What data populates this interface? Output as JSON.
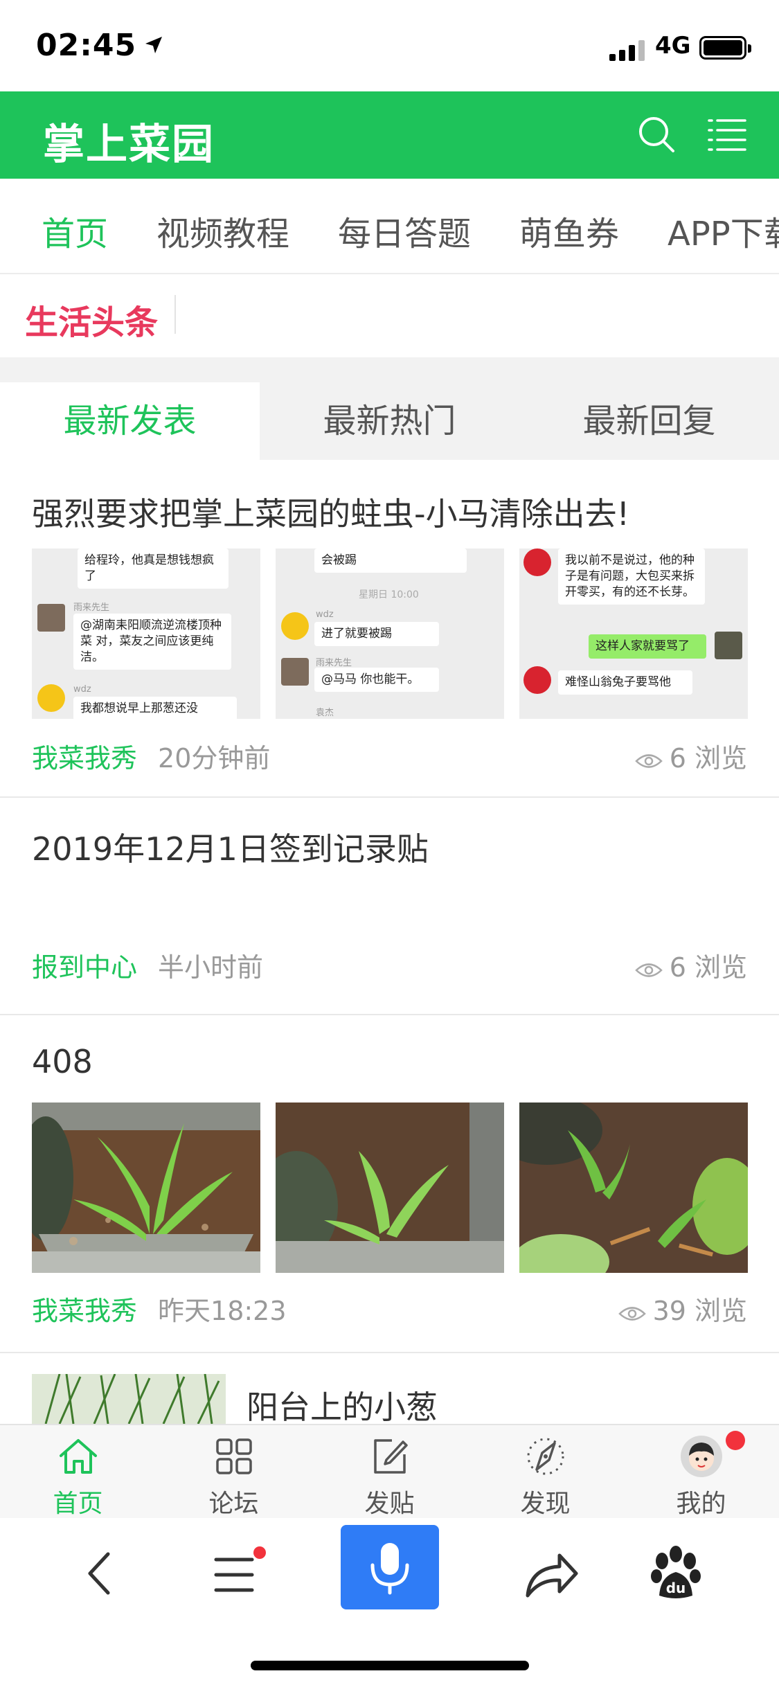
{
  "status_bar": {
    "time": "02:45",
    "network": "4G"
  },
  "header": {
    "title": "掌上菜园"
  },
  "nav_tabs": [
    {
      "label": "首页",
      "active": true
    },
    {
      "label": "视频教程",
      "active": false
    },
    {
      "label": "每日答题",
      "active": false
    },
    {
      "label": "萌鱼券",
      "active": false
    },
    {
      "label": "APP下载",
      "active": false
    }
  ],
  "headline": {
    "label": "生活头条"
  },
  "segment_tabs": [
    {
      "label": "最新发表",
      "active": true
    },
    {
      "label": "最新热门",
      "active": false
    },
    {
      "label": "最新回复",
      "active": false
    }
  ],
  "posts": [
    {
      "title": "强烈要求把掌上菜园的蛀虫-小马清除出去!",
      "category": "我菜我秀",
      "time": "20分钟前",
      "views": "6 浏览",
      "chat_1": {
        "msg_a": "给程玲，他真是想钱想疯了",
        "name_a": "雨来先生",
        "msg_b": "@湖南耒阳顺流逆流楼顶种菜 对，菜友之间应该更纯洁。",
        "name_b": "wdz",
        "msg_c": "我都想说早上那葱还没"
      },
      "chat_2": {
        "msg_a": "会被踢",
        "timestamp": "星期日 10:00",
        "name_a": "wdz",
        "msg_b": "进了就要被踢",
        "name_b": "雨来先生",
        "msg_c": "@马马 你也能干。",
        "name_c": "袁杰"
      },
      "chat_3": {
        "msg_a": "我以前不是说过，他的种子是有问题，大包买来拆开零买，有的还不长芽。",
        "msg_b": "这样人家就要骂了",
        "msg_c": "难怪山翁兔子要骂他"
      }
    },
    {
      "title": "2019年12月1日签到记录贴",
      "category": "报到中心",
      "time": "半小时前",
      "views": "6 浏览"
    },
    {
      "title": "408",
      "category": "我菜我秀",
      "time": "昨天18:23",
      "views": "39 浏览"
    },
    {
      "title": "阳台上的小葱"
    }
  ],
  "app_tabbar": [
    {
      "label": "首页",
      "icon": "home-icon",
      "active": true
    },
    {
      "label": "论坛",
      "icon": "grid-icon",
      "active": false
    },
    {
      "label": "发贴",
      "icon": "compose-icon",
      "active": false
    },
    {
      "label": "发现",
      "icon": "compass-icon",
      "active": false
    },
    {
      "label": "我的",
      "icon": "avatar-icon",
      "active": false
    }
  ],
  "colors": {
    "brand_green": "#1ec35a",
    "headline_red": "#e8395d",
    "mic_blue": "#2f7cf6",
    "badge_red": "#f2323c"
  }
}
